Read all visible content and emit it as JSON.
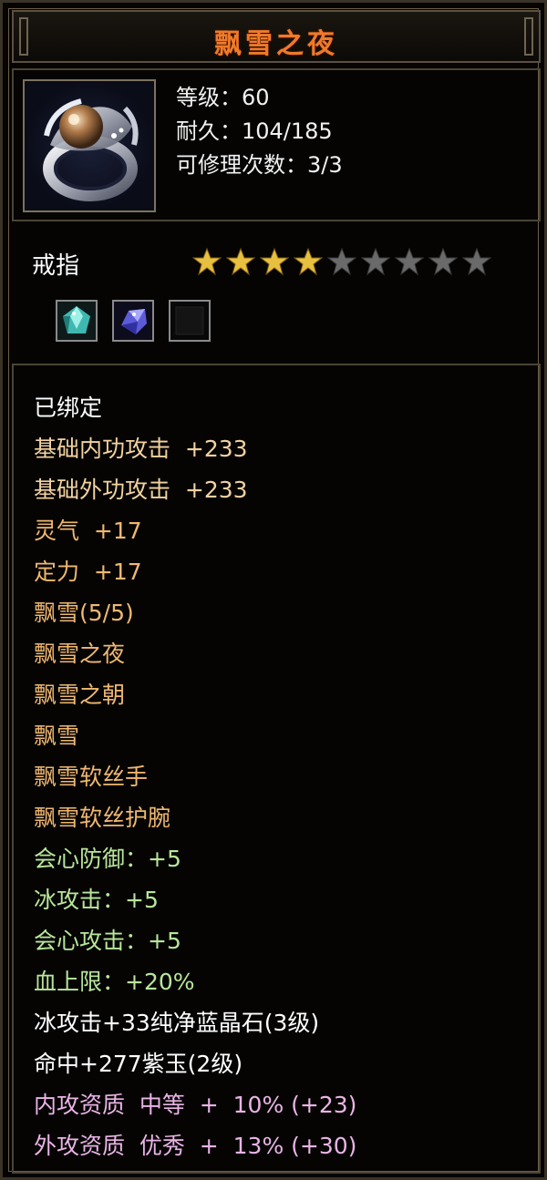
{
  "item": {
    "name": "飘雪之夜",
    "level": "等级：60",
    "durability": "耐久：104/185",
    "repairs": "可修理次数：3/3",
    "type": "戒指",
    "star_rating": {
      "filled": 4,
      "total": 9
    },
    "gems": [
      "teal-gem-icon",
      "blue-purple-gem-icon",
      "empty-socket-icon"
    ],
    "icon": "silver-pearl-ring-icon"
  },
  "details": [
    {
      "text": "已绑定",
      "color": "white"
    },
    {
      "text": "基础内功攻击  +233",
      "color": "tan"
    },
    {
      "text": "基础外功攻击  +233",
      "color": "tan"
    },
    {
      "text": "灵气  +17",
      "color": "orange"
    },
    {
      "text": "定力  +17",
      "color": "orange"
    },
    {
      "text": "飘雪(5/5)",
      "color": "orange"
    },
    {
      "text": "飘雪之夜",
      "color": "orange"
    },
    {
      "text": "飘雪之朝",
      "color": "orange"
    },
    {
      "text": "飘雪",
      "color": "orange"
    },
    {
      "text": "飘雪软丝手",
      "color": "orange"
    },
    {
      "text": "飘雪软丝护腕",
      "color": "orange"
    },
    {
      "text": "会心防御：+5",
      "color": "green"
    },
    {
      "text": "冰攻击：+5",
      "color": "green"
    },
    {
      "text": "会心攻击：+5",
      "color": "green"
    },
    {
      "text": "血上限：+20%",
      "color": "green"
    },
    {
      "text": "冰攻击+33纯净蓝晶石(3级)",
      "color": "white"
    },
    {
      "text": "命中+277紫玉(2级)",
      "color": "white"
    },
    {
      "text": "内攻资质  中等  +  10% (+23)",
      "color": "pink"
    },
    {
      "text": "外攻资质  优秀  +  13% (+30)",
      "color": "pink"
    }
  ],
  "colors": {
    "title": "#f07a2a",
    "star_filled": "#e8c040",
    "star_empty": "#6a6a6a",
    "white": "#ffffff",
    "tan": "#f2d2a0",
    "orange": "#f0b870",
    "green": "#b8e69a",
    "pink": "#eab4e6"
  }
}
